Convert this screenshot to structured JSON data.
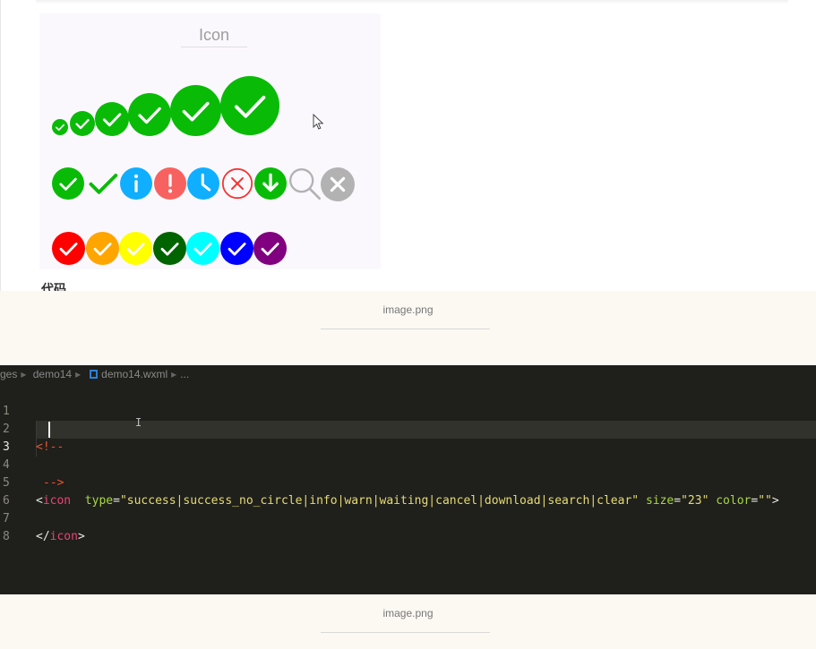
{
  "demo": {
    "title": "Icon",
    "icons_row1": [
      {
        "name": "success-icon-size-1",
        "color": "#09bb07"
      },
      {
        "name": "success-icon-size-2",
        "color": "#09bb07"
      },
      {
        "name": "success-icon-size-3",
        "color": "#09bb07"
      },
      {
        "name": "success-icon-size-4",
        "color": "#09bb07"
      },
      {
        "name": "success-icon-size-5",
        "color": "#09bb07"
      },
      {
        "name": "success-icon-size-6",
        "color": "#09bb07"
      }
    ],
    "icons_row2": [
      {
        "name": "success-icon",
        "color": "#09bb07"
      },
      {
        "name": "success-no-circle-icon",
        "color": "#09bb07"
      },
      {
        "name": "info-icon",
        "color": "#10aeff"
      },
      {
        "name": "warn-icon",
        "color": "#f76260"
      },
      {
        "name": "waiting-icon",
        "color": "#10aeff"
      },
      {
        "name": "cancel-icon",
        "color": "#f43530"
      },
      {
        "name": "download-icon",
        "color": "#09bb07"
      },
      {
        "name": "search-icon",
        "color": "#b2b2b2"
      },
      {
        "name": "clear-icon",
        "color": "#b2b2b2"
      }
    ],
    "icons_row3": [
      {
        "name": "success-icon-red",
        "color": "#ff0000"
      },
      {
        "name": "success-icon-orange",
        "color": "#ffa500"
      },
      {
        "name": "success-icon-yellow",
        "color": "#ffff00"
      },
      {
        "name": "success-icon-green",
        "color": "#006400"
      },
      {
        "name": "success-icon-cyan",
        "color": "#00ffff"
      },
      {
        "name": "success-icon-blue",
        "color": "#0000ff"
      },
      {
        "name": "success-icon-purple",
        "color": "#800080"
      }
    ]
  },
  "code_heading": "代码",
  "captions": {
    "first": "image.png",
    "second": "image.png"
  },
  "editor": {
    "breadcrumb": {
      "seg1": "ges",
      "seg2": "demo14",
      "seg3": "demo14.wxml",
      "seg4": "..."
    },
    "line_numbers": [
      "1",
      "2",
      "3",
      "4",
      "5",
      "6",
      "7",
      "8"
    ],
    "line2": "<!--",
    "line4": "-->",
    "line5": {
      "open": "<",
      "tag": "icon",
      "type_attr": "type",
      "type_value": "\"success|success_no_circle|info|warn|waiting|cancel|download|search|clear\"",
      "size_attr": "size",
      "size_value": "\"23\"",
      "color_attr": "color",
      "color_value": "\"\"",
      "close": ">"
    },
    "line7": {
      "open": "</",
      "tag": "icon",
      "close": ">"
    }
  }
}
